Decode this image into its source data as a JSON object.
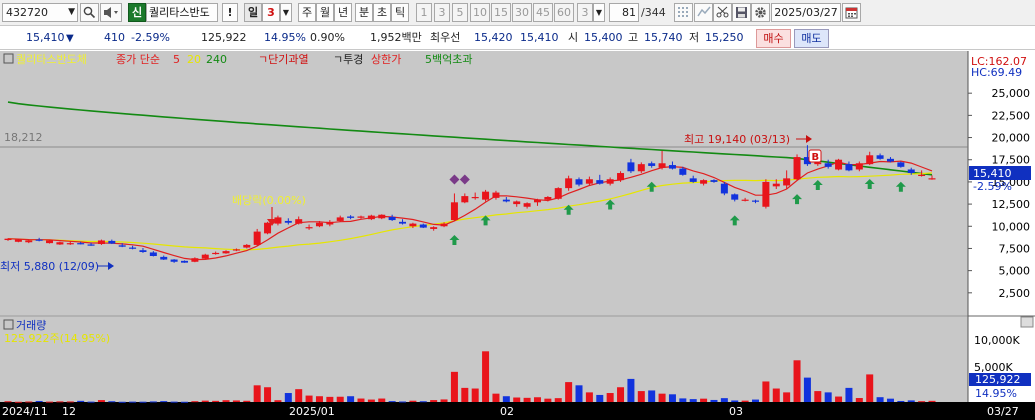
{
  "toolbar": {
    "code": "432720",
    "badge": "신",
    "stock_name": "퀄리타스반도",
    "exclaim": "!",
    "period_sel": "일",
    "period_num": "3",
    "tabs": [
      "주",
      "월",
      "년",
      "분",
      "초",
      "틱"
    ],
    "num_buttons": [
      "1",
      "3",
      "5",
      "10",
      "15",
      "30",
      "45",
      "60"
    ],
    "n_select": "3",
    "count": "81",
    "total": "/344",
    "date": "2025/03/27"
  },
  "info": {
    "price": "15,410",
    "arrow": "▼",
    "change": "410",
    "change_pct": "-2.59%",
    "volume": "125,922",
    "vol_ratio": "14.95%",
    "turnover": "0.90%",
    "amount": "1,952백만",
    "pref_label": "최우선",
    "best_ask": "15,420",
    "best_bid": "15,410",
    "open_label": "시",
    "open": "15,400",
    "high_label": "고",
    "high": "15,740",
    "low_label": "저",
    "low": "15,250",
    "buy": "매수",
    "sell": "매도"
  },
  "price_panel": {
    "legend": {
      "name": "퀄리타스반도체",
      "ma_label": "종가 단순",
      "ma5": "5",
      "ma20": "20",
      "ma240": "240",
      "tag1": "ㄱ단기과열",
      "tag2": "ㄱ투경",
      "tag3": "상한가",
      "tag4": "5백억초과"
    },
    "lc": "LC:162.07",
    "hc": "HC:69.49",
    "ref_value": "18,212",
    "high_annotation": "최고 19,140 (03/13)",
    "low_annotation": "최저 5,880 (12/09)",
    "dividend_annotation": "배당락(0.00%)",
    "b_badge": "B",
    "current_price": "15,410",
    "current_change": "-2.59%",
    "y_ticks": [
      "25,000",
      "22,500",
      "20,000",
      "17,500",
      "15,000",
      "12,500",
      "10,000",
      "7,500",
      "5,000",
      "2,500"
    ]
  },
  "volume_panel": {
    "title": "거래량",
    "value": "125,922주(14.95%)",
    "y_ticks": [
      "10,000K",
      "5,000K"
    ],
    "current_volume": "125,922",
    "current_pct": "14.95%"
  },
  "x_axis": [
    "2024/11",
    "12",
    "2025/01",
    "02",
    "03",
    "03/27"
  ],
  "colors": {
    "up": "#e8141b",
    "down": "#1133dd",
    "ma5": "#e02020",
    "ma20": "#e6e600",
    "ma240": "#138a13",
    "arrow": "#1f9a4a",
    "chart_bg": "#c8c8c8",
    "axis_bg": "#ffffff"
  },
  "chart_data": {
    "type": "candlestick",
    "ylim": [
      0,
      27500
    ],
    "candles": [
      {
        "o": 8450,
        "h": 8650,
        "l": 8350,
        "c": 8600
      },
      {
        "o": 8250,
        "h": 8600,
        "l": 8200,
        "c": 8500
      },
      {
        "o": 8200,
        "h": 8500,
        "l": 8100,
        "c": 8400
      },
      {
        "o": 8500,
        "h": 8700,
        "l": 8300,
        "c": 8450
      },
      {
        "o": 8100,
        "h": 8450,
        "l": 8050,
        "c": 8400
      },
      {
        "o": 7950,
        "h": 8250,
        "l": 7900,
        "c": 8200
      },
      {
        "o": 8000,
        "h": 8300,
        "l": 7900,
        "c": 8100
      },
      {
        "o": 8100,
        "h": 8250,
        "l": 7950,
        "c": 8000
      },
      {
        "o": 7950,
        "h": 8150,
        "l": 7800,
        "c": 7900
      },
      {
        "o": 8000,
        "h": 8500,
        "l": 7900,
        "c": 8400
      },
      {
        "o": 8350,
        "h": 8500,
        "l": 8000,
        "c": 8050
      },
      {
        "o": 7850,
        "h": 8100,
        "l": 7650,
        "c": 7700
      },
      {
        "o": 7600,
        "h": 7800,
        "l": 7400,
        "c": 7500
      },
      {
        "o": 7300,
        "h": 7550,
        "l": 7000,
        "c": 7100
      },
      {
        "o": 7050,
        "h": 7200,
        "l": 6600,
        "c": 6650
      },
      {
        "o": 6550,
        "h": 6700,
        "l": 6200,
        "c": 6250
      },
      {
        "o": 6250,
        "h": 6300,
        "l": 5880,
        "c": 6000
      },
      {
        "o": 6100,
        "h": 6150,
        "l": 5880,
        "c": 5900
      },
      {
        "o": 6000,
        "h": 6500,
        "l": 5950,
        "c": 6400
      },
      {
        "o": 6350,
        "h": 6900,
        "l": 6300,
        "c": 6800
      },
      {
        "o": 6900,
        "h": 7150,
        "l": 6800,
        "c": 7000
      },
      {
        "o": 6950,
        "h": 7300,
        "l": 6900,
        "c": 7200
      },
      {
        "o": 7300,
        "h": 7500,
        "l": 7200,
        "c": 7400
      },
      {
        "o": 7600,
        "h": 8000,
        "l": 7500,
        "c": 7900
      },
      {
        "o": 7900,
        "h": 9700,
        "l": 7800,
        "c": 9400
      },
      {
        "o": 9200,
        "h": 10500,
        "l": 9100,
        "c": 10400
      },
      {
        "o": 10300,
        "h": 11200,
        "l": 10100,
        "c": 11000
      },
      {
        "o": 10600,
        "h": 10900,
        "l": 10200,
        "c": 10400
      },
      {
        "o": 10300,
        "h": 11100,
        "l": 10200,
        "c": 10800
      },
      {
        "o": 9800,
        "h": 10200,
        "l": 9600,
        "c": 9900
      },
      {
        "o": 10000,
        "h": 10600,
        "l": 9900,
        "c": 10400
      },
      {
        "o": 10200,
        "h": 10700,
        "l": 10000,
        "c": 10500
      },
      {
        "o": 10600,
        "h": 11200,
        "l": 10500,
        "c": 11000
      },
      {
        "o": 11100,
        "h": 11250,
        "l": 10800,
        "c": 10950
      },
      {
        "o": 11000,
        "h": 11200,
        "l": 10850,
        "c": 11100
      },
      {
        "o": 10800,
        "h": 11300,
        "l": 10700,
        "c": 11200
      },
      {
        "o": 10900,
        "h": 11350,
        "l": 10800,
        "c": 11300
      },
      {
        "o": 11050,
        "h": 11300,
        "l": 10600,
        "c": 10700
      },
      {
        "o": 10500,
        "h": 10800,
        "l": 10200,
        "c": 10300
      },
      {
        "o": 10000,
        "h": 10400,
        "l": 9800,
        "c": 10300
      },
      {
        "o": 10200,
        "h": 10300,
        "l": 9800,
        "c": 9850
      },
      {
        "o": 9700,
        "h": 10000,
        "l": 9500,
        "c": 9900
      },
      {
        "o": 10000,
        "h": 10450,
        "l": 9900,
        "c": 10300
      },
      {
        "o": 10700,
        "h": 13700,
        "l": 10600,
        "c": 12700
      },
      {
        "o": 12700,
        "h": 13700,
        "l": 12600,
        "c": 13400
      },
      {
        "o": 13200,
        "h": 13800,
        "l": 13000,
        "c": 13300
      },
      {
        "o": 13000,
        "h": 14100,
        "l": 12800,
        "c": 13900
      },
      {
        "o": 13200,
        "h": 14000,
        "l": 13000,
        "c": 13800
      },
      {
        "o": 13000,
        "h": 13300,
        "l": 12700,
        "c": 12800
      },
      {
        "o": 12500,
        "h": 12900,
        "l": 12200,
        "c": 12800
      },
      {
        "o": 12200,
        "h": 12700,
        "l": 12000,
        "c": 12600
      },
      {
        "o": 12700,
        "h": 13100,
        "l": 12300,
        "c": 13000
      },
      {
        "o": 13000,
        "h": 13400,
        "l": 12800,
        "c": 13300
      },
      {
        "o": 13100,
        "h": 14400,
        "l": 13000,
        "c": 14300
      },
      {
        "o": 14300,
        "h": 15700,
        "l": 14000,
        "c": 15400
      },
      {
        "o": 15300,
        "h": 15500,
        "l": 14500,
        "c": 14700
      },
      {
        "o": 14800,
        "h": 15600,
        "l": 14600,
        "c": 15300
      },
      {
        "o": 15200,
        "h": 15800,
        "l": 14700,
        "c": 14800
      },
      {
        "o": 14800,
        "h": 15500,
        "l": 14600,
        "c": 15300
      },
      {
        "o": 15200,
        "h": 16200,
        "l": 15000,
        "c": 16000
      },
      {
        "o": 17200,
        "h": 17600,
        "l": 16000,
        "c": 16200
      },
      {
        "o": 16200,
        "h": 17200,
        "l": 16000,
        "c": 17000
      },
      {
        "o": 17100,
        "h": 17300,
        "l": 16600,
        "c": 16800
      },
      {
        "o": 16600,
        "h": 18500,
        "l": 16400,
        "c": 17100
      },
      {
        "o": 16900,
        "h": 17300,
        "l": 16400,
        "c": 16500
      },
      {
        "o": 16500,
        "h": 16700,
        "l": 15700,
        "c": 15800
      },
      {
        "o": 15400,
        "h": 15700,
        "l": 14900,
        "c": 15000
      },
      {
        "o": 14800,
        "h": 15300,
        "l": 14600,
        "c": 15200
      },
      {
        "o": 15200,
        "h": 15300,
        "l": 14900,
        "c": 15000
      },
      {
        "o": 14800,
        "h": 15000,
        "l": 13500,
        "c": 13700
      },
      {
        "o": 13600,
        "h": 13700,
        "l": 12800,
        "c": 13000
      },
      {
        "o": 13000,
        "h": 13200,
        "l": 12800,
        "c": 13000
      },
      {
        "o": 12900,
        "h": 13000,
        "l": 12600,
        "c": 12800
      },
      {
        "o": 12200,
        "h": 15300,
        "l": 12000,
        "c": 15000
      },
      {
        "o": 14500,
        "h": 15300,
        "l": 14200,
        "c": 14800
      },
      {
        "o": 14600,
        "h": 16300,
        "l": 14200,
        "c": 15400
      },
      {
        "o": 15300,
        "h": 18100,
        "l": 15200,
        "c": 17800
      },
      {
        "o": 17800,
        "h": 19140,
        "l": 16800,
        "c": 17000
      },
      {
        "o": 17000,
        "h": 17900,
        "l": 16800,
        "c": 17200
      },
      {
        "o": 17100,
        "h": 17500,
        "l": 16500,
        "c": 16700
      },
      {
        "o": 16400,
        "h": 17600,
        "l": 16300,
        "c": 17500
      },
      {
        "o": 17000,
        "h": 17300,
        "l": 16200,
        "c": 16300
      },
      {
        "o": 16400,
        "h": 17300,
        "l": 16200,
        "c": 17100
      },
      {
        "o": 17000,
        "h": 18400,
        "l": 16900,
        "c": 18000
      },
      {
        "o": 18000,
        "h": 18200,
        "l": 17500,
        "c": 17600
      },
      {
        "o": 17600,
        "h": 17800,
        "l": 17200,
        "c": 17300
      },
      {
        "o": 17200,
        "h": 17300,
        "l": 16600,
        "c": 16700
      },
      {
        "o": 16400,
        "h": 16600,
        "l": 15800,
        "c": 16000
      },
      {
        "o": 15700,
        "h": 16300,
        "l": 15600,
        "c": 15800
      },
      {
        "o": 15400,
        "h": 15740,
        "l": 15250,
        "c": 15410
      }
    ],
    "volumes": [
      120,
      40,
      80,
      160,
      60,
      100,
      90,
      180,
      60,
      300,
      120,
      40,
      60,
      50,
      90,
      140,
      60,
      40,
      130,
      210,
      180,
      280,
      240,
      190,
      2600,
      2300,
      280,
      1400,
      2000,
      1000,
      900,
      800,
      820,
      900,
      540,
      380,
      540,
      140,
      80,
      200,
      120,
      300,
      400,
      4700,
      2200,
      2100,
      7900,
      1300,
      900,
      700,
      650,
      740,
      520,
      600,
      3100,
      2600,
      1500,
      1100,
      1400,
      2300,
      3600,
      1700,
      1800,
      1300,
      1200,
      560,
      450,
      520,
      320,
      600,
      240,
      210,
      380,
      3200,
      2100,
      1500,
      6500,
      3800,
      1700,
      1500,
      850,
      2200,
      620,
      4300,
      750,
      520,
      160,
      250,
      130,
      180
    ],
    "markers": {
      "up_arrows": [
        43,
        46,
        54,
        58,
        62,
        70,
        76,
        78,
        83,
        86
      ],
      "diamonds": [
        43,
        44
      ]
    }
  }
}
